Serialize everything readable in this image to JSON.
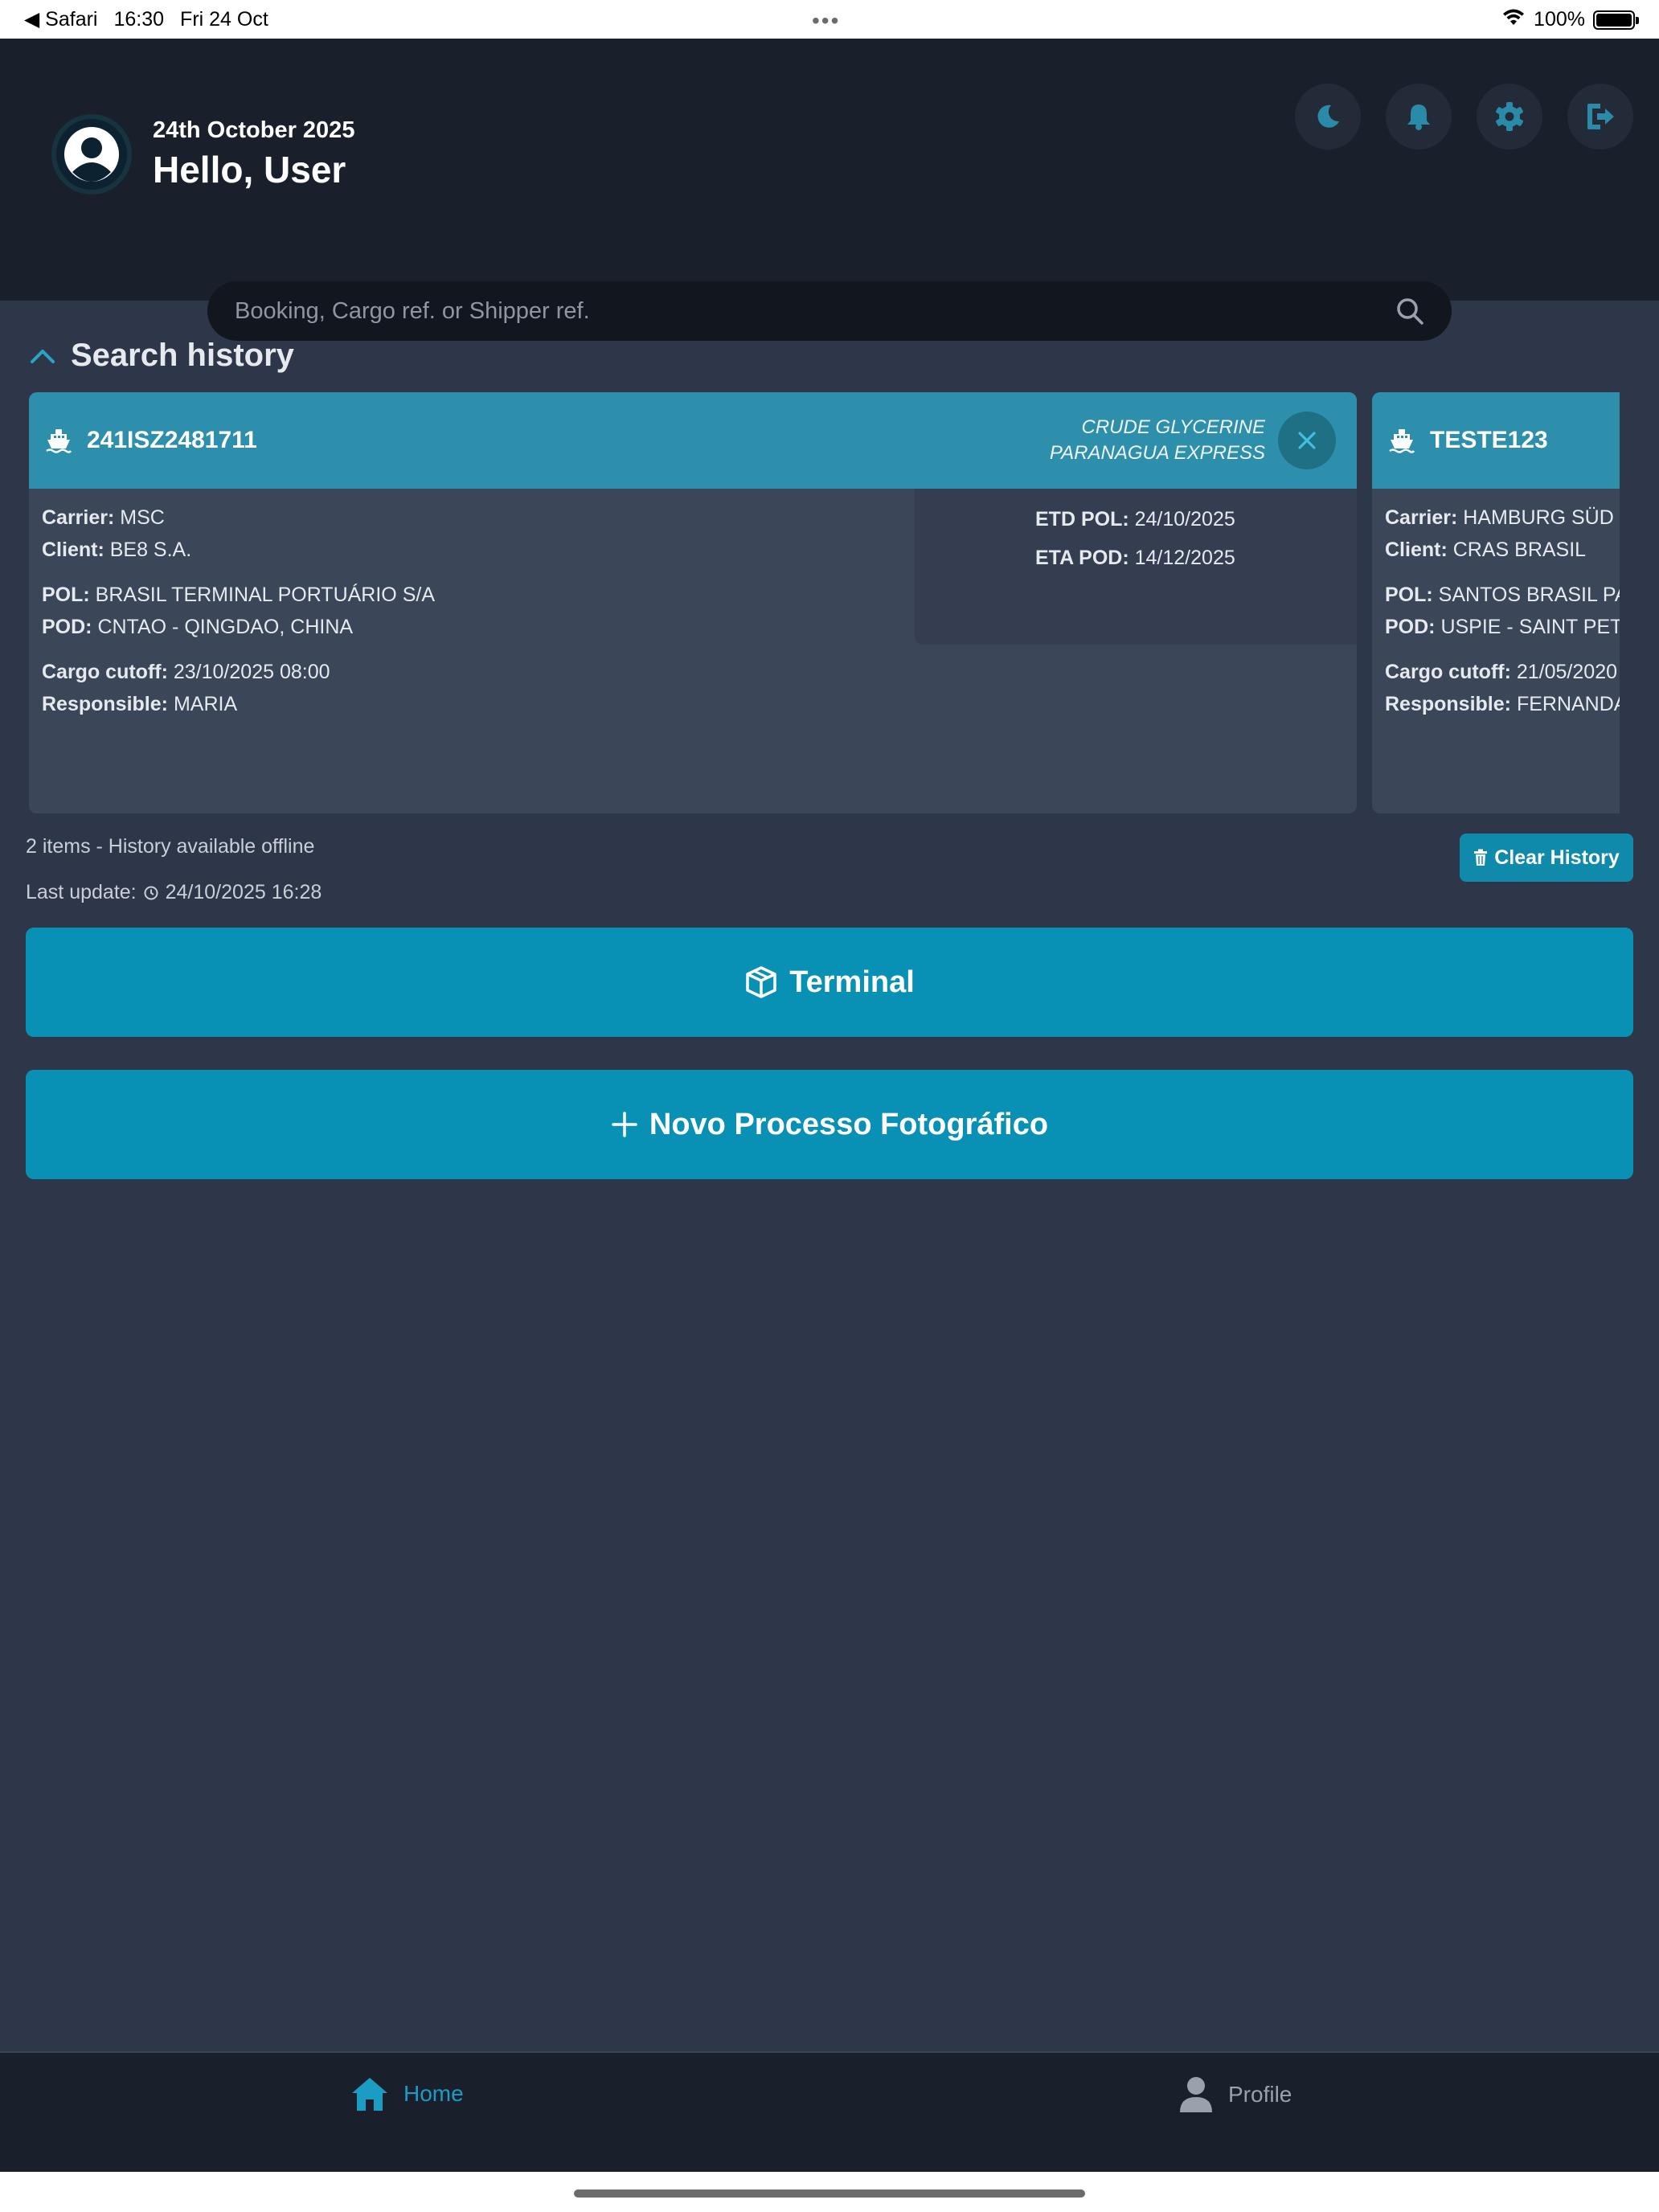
{
  "status_bar": {
    "back_app": "◀ Safari",
    "time": "16:30",
    "date": "Fri 24 Oct",
    "dots": "•••",
    "battery": "100%"
  },
  "header": {
    "date": "24th October 2025",
    "greeting": "Hello, User",
    "icons": [
      "moon-icon",
      "bell-icon",
      "gear-icon",
      "logout-icon"
    ]
  },
  "search": {
    "placeholder": "Booking, Cargo ref. or Shipper ref."
  },
  "history": {
    "title": "Search history",
    "cards": [
      {
        "ref": "241ISZ2481711",
        "vessel_line1": "CRUDE GLYCERINE",
        "vessel_line2": "PARANAGUA EXPRESS",
        "carrier_label": "Carrier:",
        "carrier": "MSC",
        "client_label": "Client:",
        "client": "BE8 S.A.",
        "pol_label": "POL:",
        "pol": "BRASIL TERMINAL PORTUÁRIO S/A",
        "pod_label": "POD:",
        "pod": "CNTAO - QINGDAO, CHINA",
        "cutoff_label": "Cargo cutoff:",
        "cutoff": "23/10/2025 08:00",
        "responsible_label": "Responsible:",
        "responsible": "MARIA",
        "etd_label": "ETD POL:",
        "etd": "24/10/2025",
        "eta_label": "ETA POD:",
        "eta": "14/12/2025"
      },
      {
        "ref": "TESTE123",
        "carrier_label": "Carrier:",
        "carrier": "HAMBURG SÜD",
        "client_label": "Client:",
        "client": "CRAS BRASIL",
        "pol_label": "POL:",
        "pol": "SANTOS BRASIL PA",
        "pod_label": "POD:",
        "pod": "USPIE - SAINT PETE",
        "cutoff_label": "Cargo cutoff:",
        "cutoff": "21/05/2020",
        "responsible_label": "Responsible:",
        "responsible": "FERNANDA"
      }
    ],
    "summary": "2 items - History available offline",
    "last_update_label": "Last update:",
    "last_update": "24/10/2025 16:28",
    "clear_label": "Clear History"
  },
  "actions": {
    "terminal_label": "Terminal",
    "new_process_label": "Novo Processo Fotográfico"
  },
  "nav": {
    "home_label": "Home",
    "profile_label": "Profile"
  },
  "colors": {
    "accent": "#0891b5",
    "card_header": "#2d8fab",
    "background": "#2e3749",
    "header_bg": "#1a1f2c"
  }
}
